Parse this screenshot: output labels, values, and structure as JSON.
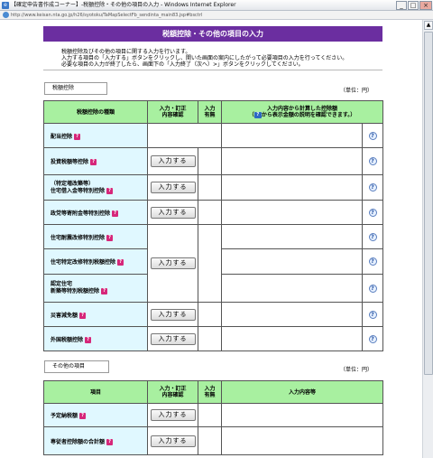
{
  "window": {
    "title": "【確定申告書作成コーナー】-税額控除・その他の項目の入力 - Windows Internet Explorer",
    "address": "http://www.keisan.nta.go.jp/h26/syotoku/TaMapSelectFb_sendinta_main83.jsp#bsctrl"
  },
  "page": {
    "title": "税額控除・その他の項目の入力",
    "intro": [
      "税額控除及びその他の項目に関する入力を行います。",
      "入力する項目の「入力する」ボタンをクリックし、開いた画面の案内にしたがって必要項目の入力を行ってください。",
      "必要な項目の入力が終了したら、画面下の「入力終了（次へ）>」ボタンをクリックしてください。"
    ]
  },
  "tax_credit": {
    "section_label": "税額控除",
    "unit": "（単位：円）",
    "headers": {
      "type": "税額控除の種類",
      "input_line1": "入力・訂正",
      "input_line2": "内容確認",
      "has_line1": "入力",
      "has_line2": "有無",
      "result_line1": "入力内容から計算した控除額",
      "result_line2_suffix": "から表示金額の説明を確認できます。）",
      "result_open_paren": "（"
    },
    "button_label": "入力する",
    "rows": [
      {
        "name": "配当控除"
      },
      {
        "name": "投資税額等控除"
      },
      {
        "name_line1": "（特定増改築等）",
        "name_line2": "住宅借入金等特別控除"
      },
      {
        "name": "政党等寄附金等特別控除"
      },
      {
        "name": "住宅耐震改修特別控除"
      },
      {
        "name": "住宅特定改修特別税額控除"
      },
      {
        "name_line1": "認定住宅",
        "name_line2": "新築等特別税額控除"
      },
      {
        "name": "災害減免額"
      },
      {
        "name": "外国税額控除"
      }
    ]
  },
  "other": {
    "section_label": "その他の項目",
    "unit": "（単位：円）",
    "headers": {
      "item": "項目",
      "input_line1": "入力・訂正",
      "input_line2": "内容確認",
      "has_line1": "入力",
      "has_line2": "有無",
      "content": "入力内容等"
    },
    "button_label": "入力する",
    "rows": [
      {
        "name": "予定納税額"
      },
      {
        "name": "専従者控除額の合計額"
      }
    ]
  },
  "icons": {
    "question": "?",
    "help": "?"
  }
}
